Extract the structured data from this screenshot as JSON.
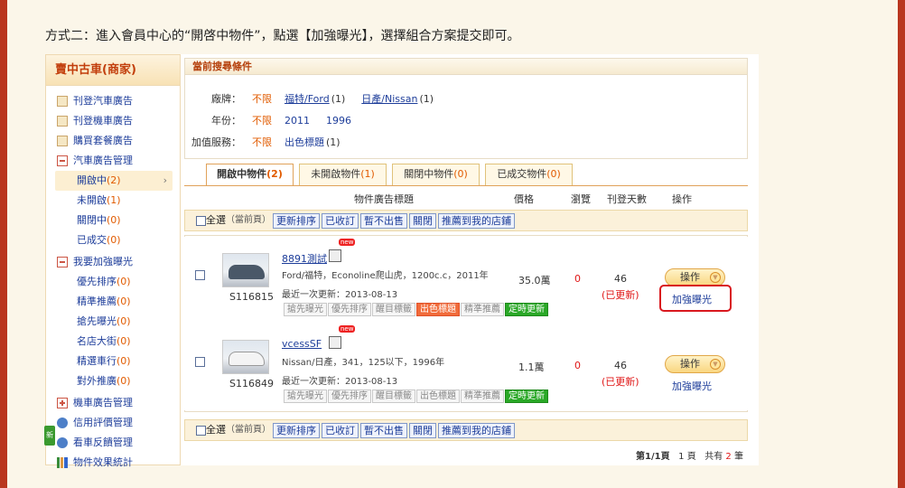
{
  "instruction": "方式二：進入會員中心的“開啓中物件”，點選【加強曝光】，選擇組合方案提交即可。",
  "sidebar": {
    "title": "賣中古車(商家)",
    "items": [
      {
        "label": "刊登汽車廣告",
        "count": ""
      },
      {
        "label": "刊登機車廣告",
        "count": ""
      },
      {
        "label": "購買套餐廣告",
        "count": ""
      },
      {
        "label": "汽車廣告管理",
        "count": ""
      },
      {
        "label": "開啟中",
        "count": "(2)"
      },
      {
        "label": "未開啟",
        "count": "(1)"
      },
      {
        "label": "關閉中",
        "count": "(0)"
      },
      {
        "label": "已成交",
        "count": "(0)"
      },
      {
        "label": "我要加強曝光",
        "count": ""
      },
      {
        "label": "優先排序",
        "count": "(0)"
      },
      {
        "label": "精準推薦",
        "count": "(0)"
      },
      {
        "label": "搶先曝光",
        "count": "(0)"
      },
      {
        "label": "名店大街",
        "count": "(0)"
      },
      {
        "label": "精選車行",
        "count": "(0)"
      },
      {
        "label": "對外推廣",
        "count": "(0)"
      },
      {
        "label": "機車廣告管理",
        "count": ""
      },
      {
        "label": "信用評價管理",
        "count": ""
      },
      {
        "label": "看車反饋管理",
        "count": ""
      },
      {
        "label": "物件效果統計",
        "count": ""
      }
    ],
    "new_badge": "新"
  },
  "search": {
    "title": "當前搜尋條件",
    "brand_label": "廠牌：",
    "year_label": "年份：",
    "service_label": "加值服務：",
    "any": "不限",
    "brand_ford": "福特/Ford",
    "brand_ford_count": "(1)",
    "brand_nissan": "日產/Nissan",
    "brand_nissan_count": "(1)",
    "year_2011": "2011",
    "year_1996": "1996",
    "service_title": "出色標題",
    "service_count": "(1)"
  },
  "tabs": [
    {
      "label": "開啟中物件",
      "count": "(2)"
    },
    {
      "label": "未開啟物件",
      "count": "(1)"
    },
    {
      "label": "關閉中物件",
      "count": "(0)"
    },
    {
      "label": "已成交物件",
      "count": "(0)"
    }
  ],
  "columns": {
    "title": "物件廣告標題",
    "price": "價格",
    "views": "瀏覽",
    "days": "刊登天數",
    "action": "操作"
  },
  "bulk": {
    "select_all": "全選",
    "current_page": "（當前頁）",
    "buttons": [
      "更新排序",
      "已收訂",
      "暫不出售",
      "關閉",
      "推薦到我的店鋪"
    ]
  },
  "listings": [
    {
      "id": "S116815",
      "title": "8891測試",
      "desc": "Ford/福特，Econoline爬山虎，1200c.c，2011年",
      "updated": "最近一次更新：2013-08-13",
      "tags": [
        "搶先曝光",
        "優先排序",
        "醒目標籤",
        "出色標題",
        "精準推薦",
        "定時更新"
      ],
      "price": "35.0萬",
      "views": "0",
      "days": "46",
      "status": "(已更新)",
      "action": "操作",
      "boost": "加強曝光"
    },
    {
      "id": "S116849",
      "title": "vcessSF",
      "desc": "Nissan/日產，341，125以下，1996年",
      "updated": "最近一次更新：2013-08-13",
      "tags": [
        "搶先曝光",
        "優先排序",
        "醒目標籤",
        "出色標題",
        "精準推薦",
        "定時更新"
      ],
      "price": "1.1萬",
      "views": "0",
      "days": "46",
      "status": "(已更新)",
      "action": "操作",
      "boost": "加強曝光"
    }
  ],
  "new_label": "new",
  "pager": {
    "page_prefix": "第",
    "page_current": "1/1",
    "page_suffix": "頁",
    "page_num": "1",
    "page_unit": "頁",
    "total_prefix": "共有",
    "total": "2",
    "total_unit": "筆"
  },
  "colors": {
    "brand_border": "#b9361f",
    "accent": "#e15b00",
    "link": "#1d3d9a",
    "highlight": "#d9181e"
  }
}
